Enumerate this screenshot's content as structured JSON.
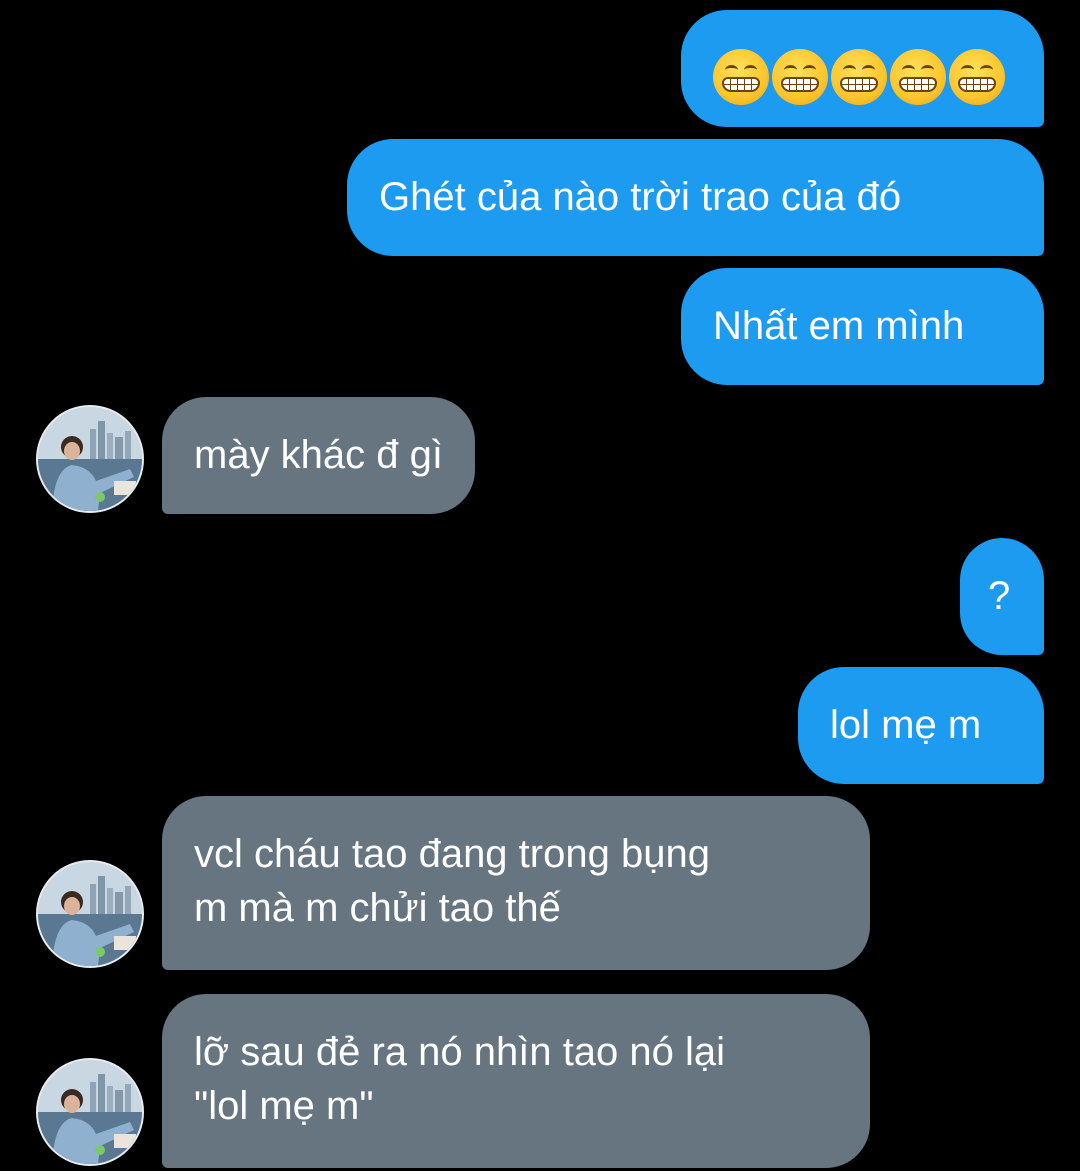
{
  "messages": [
    {
      "direction": "sent",
      "type": "emoji",
      "emoji_name": "grinning-face-with-smiling-eyes",
      "count": 5
    },
    {
      "direction": "sent",
      "text": "Ghét của nào trời trao của đó"
    },
    {
      "direction": "sent",
      "text": "Nhất em mình"
    },
    {
      "direction": "received",
      "text": "mày khác đ gì"
    },
    {
      "direction": "sent",
      "text": "?"
    },
    {
      "direction": "sent",
      "text": "lol mẹ m"
    },
    {
      "direction": "received",
      "lines": [
        "vcl cháu tao đang trong bụng",
        "m mà m chửi tao thế"
      ]
    },
    {
      "direction": "received",
      "lines": [
        "lỡ sau đẻ ra nó nhìn tao nó lại",
        "\"lol mẹ m\""
      ]
    }
  ],
  "colors": {
    "background": "#000000",
    "sent_bubble": "#1d9bf0",
    "received_bubble": "#66757f",
    "text": "#ffffff"
  },
  "icons": {
    "avatar": "contact-avatar-photo",
    "emoji": "grinning-face-with-smiling-eyes"
  }
}
